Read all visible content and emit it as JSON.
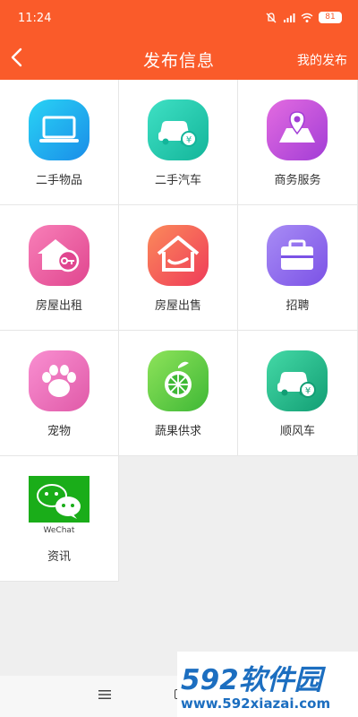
{
  "status": {
    "time": "11:24",
    "battery": "81"
  },
  "nav": {
    "title": "发布信息",
    "right_label": "我的发布"
  },
  "categories": [
    {
      "label": "二手物品",
      "icon": "laptop-icon"
    },
    {
      "label": "二手汽车",
      "icon": "car-price-icon"
    },
    {
      "label": "商务服务",
      "icon": "map-pin-icon"
    },
    {
      "label": "房屋出租",
      "icon": "house-key-icon"
    },
    {
      "label": "房屋出售",
      "icon": "house-hand-icon"
    },
    {
      "label": "招聘",
      "icon": "briefcase-icon"
    },
    {
      "label": "宠物",
      "icon": "paw-icon"
    },
    {
      "label": "蔬果供求",
      "icon": "fruit-icon"
    },
    {
      "label": "顺风车",
      "icon": "car-price-icon"
    },
    {
      "label": "资讯",
      "icon": "wechat-icon",
      "icon_caption": "WeChat"
    }
  ],
  "watermark": {
    "brand": "592软件园",
    "url": "www.592xiazai.com"
  },
  "colors": {
    "header": "#fa5b2a",
    "brand_blue": "#1c6ec0",
    "wechat_green": "#1aad19"
  }
}
